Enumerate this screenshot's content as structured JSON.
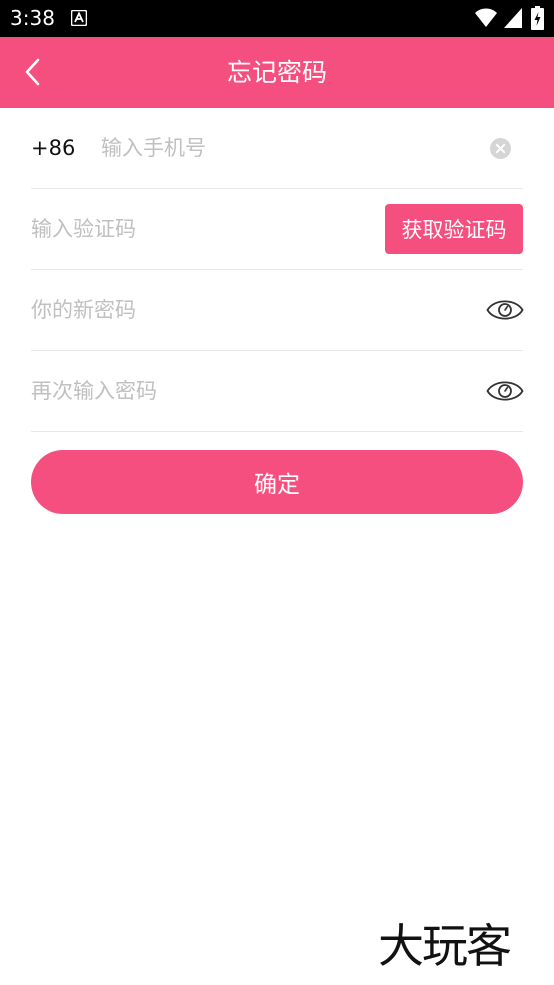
{
  "status_bar": {
    "time": "3:38"
  },
  "header": {
    "title": "忘记密码"
  },
  "phone_row": {
    "country_code": "+86",
    "placeholder": "输入手机号"
  },
  "code_row": {
    "placeholder": "输入验证码",
    "get_code_label": "获取验证码"
  },
  "new_password_row": {
    "placeholder": "你的新密码"
  },
  "confirm_password_row": {
    "placeholder": "再次输入密码"
  },
  "confirm_button": {
    "label": "确定"
  },
  "watermark": {
    "text": "大玩客"
  },
  "colors": {
    "accent": "#f54f7f",
    "divider": "#e8e8e8",
    "placeholder": "#c0c0c0"
  },
  "icons": [
    "back-arrow-icon",
    "clear-icon",
    "eye-icon",
    "wifi-icon",
    "signal-icon",
    "battery-icon"
  ]
}
